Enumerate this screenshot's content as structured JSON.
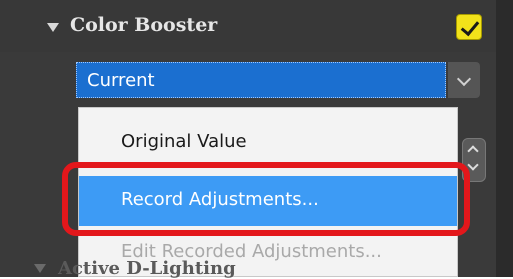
{
  "panel": {
    "section_title": "Color Booster",
    "section_enabled": true,
    "next_section_title": "Active D-Lighting"
  },
  "dropdown": {
    "selected_value": "Current",
    "options": [
      {
        "label": "Original Value",
        "state": "normal"
      },
      {
        "label": "Record Adjustments...",
        "state": "highlighted"
      },
      {
        "label": "Edit Recorded Adjustments...",
        "state": "disabled"
      }
    ]
  },
  "colors": {
    "selection_blue": "#1b6fd0",
    "menu_highlight": "#3d9bf5",
    "callout_red": "#e3171b",
    "checkbox_yellow": "#f2e21a"
  }
}
